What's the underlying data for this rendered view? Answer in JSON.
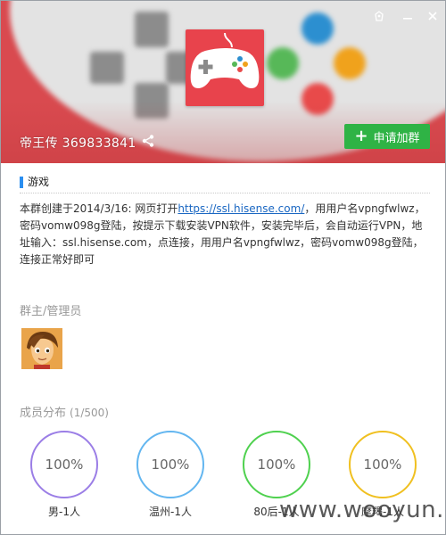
{
  "window": {
    "skin_icon": "skin-icon",
    "minimize_icon": "minimize-icon",
    "close_icon": "close-icon"
  },
  "banner": {
    "group_name": "帝王传",
    "group_id": "369833841",
    "share_icon": "share-icon",
    "join_label": "申请加群",
    "logo_icon": "gamepad-icon",
    "colors": {
      "banner": "#d94a4f",
      "logo": "#e8434c",
      "join": "#2fb345"
    }
  },
  "category": {
    "label": "游戏"
  },
  "description": {
    "before_link": "本群创建于2014/3/16: 网页打开",
    "link": "https://ssl.hisense.com/",
    "after_link": "，用用户名vpngfwlwz，密码vomw098g登陆，按提示下载安装VPN软件，安装完毕后，会自动运行VPN，地址输入：ssl.hisense.com，点连接，用用户名vpngfwlwz，密码vomw098g登陆，连接正常好即可"
  },
  "admins": {
    "title": "群主/管理员",
    "avatar_icon": "cartoon-boy-avatar"
  },
  "members": {
    "title": "成员分布",
    "count": "(1/500)",
    "stats": [
      {
        "value": "100%",
        "label": "男-1人",
        "color": "#9b7ee6"
      },
      {
        "value": "100%",
        "label": "温州-1人",
        "color": "#63b6f0"
      },
      {
        "value": "100%",
        "label": "80后-1人",
        "color": "#4fd14f"
      },
      {
        "value": "100%",
        "label": "摩羯-1人",
        "color": "#f0c020"
      }
    ]
  },
  "watermark": "www.wooyun.org"
}
